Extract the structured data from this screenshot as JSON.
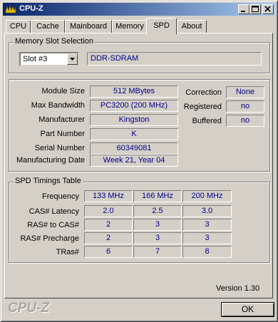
{
  "window": {
    "title": "CPU-Z"
  },
  "tabs": [
    {
      "label": "CPU",
      "active": false
    },
    {
      "label": "Cache",
      "active": false
    },
    {
      "label": "Mainboard",
      "active": false
    },
    {
      "label": "Memory",
      "active": false
    },
    {
      "label": "SPD",
      "active": true
    },
    {
      "label": "About",
      "active": false
    }
  ],
  "memory_slot": {
    "group_title": "Memory Slot Selection",
    "selected_slot": "Slot #3",
    "type": "DDR-SDRAM"
  },
  "module": {
    "size_label": "Module Size",
    "size": "512 MBytes",
    "bandwidth_label": "Max Bandwidth",
    "bandwidth": "PC3200 (200 MHz)",
    "manufacturer_label": "Manufacturer",
    "manufacturer": "Kingston",
    "part_label": "Part Number",
    "part": "K",
    "serial_label": "Serial Number",
    "serial": "60349081",
    "date_label": "Manufacturing Date",
    "date": "Week 21, Year 04",
    "correction_label": "Correction",
    "correction": "None",
    "registered_label": "Registered",
    "registered": "no",
    "buffered_label": "Buffered",
    "buffered": "no"
  },
  "timings": {
    "group_title": "SPD Timings Table",
    "rows": [
      {
        "label": "Frequency",
        "values": [
          "133 MHz",
          "166 MHz",
          "200 MHz"
        ]
      },
      {
        "label": "CAS# Latency",
        "values": [
          "2.0",
          "2.5",
          "3.0"
        ]
      },
      {
        "label": "RAS# to CAS#",
        "values": [
          "2",
          "3",
          "3"
        ]
      },
      {
        "label": "RAS# Precharge",
        "values": [
          "2",
          "3",
          "3"
        ]
      },
      {
        "label": "TRas#",
        "values": [
          "6",
          "7",
          "8"
        ]
      }
    ]
  },
  "footer": {
    "version": "Version 1.30",
    "logo": "CPU-Z",
    "ok_label": "OK"
  }
}
